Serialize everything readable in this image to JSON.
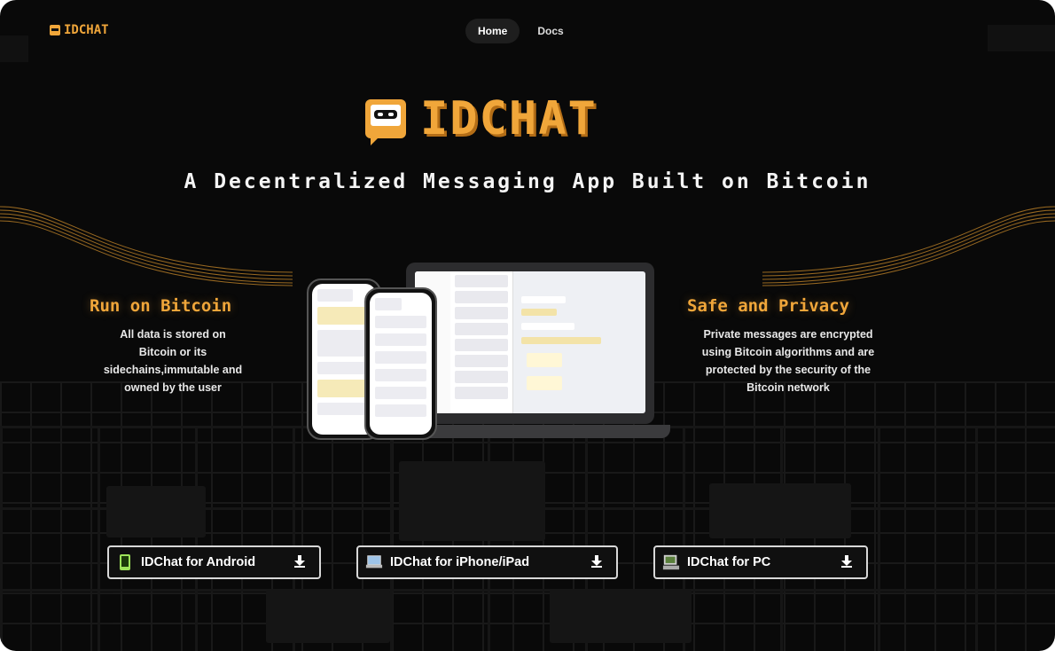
{
  "brand": {
    "name_small": "IDCHAT",
    "name_large": "IDCHAT",
    "accent": "#f0a63a"
  },
  "nav": {
    "items": [
      {
        "label": "Home",
        "active": true
      },
      {
        "label": "Docs",
        "active": false
      }
    ]
  },
  "hero": {
    "tagline": "A Decentralized Messaging App Built on Bitcoin"
  },
  "features": {
    "left": {
      "title": "Run on Bitcoin",
      "lines": [
        "All data is stored on",
        "Bitcoin or its",
        "sidechains,immutable and",
        "owned by the user"
      ]
    },
    "right": {
      "title": "Safe and Privacy",
      "lines": [
        "Private messages are encrypted",
        "using Bitcoin algorithms and are",
        "protected by the security of the",
        "Bitcoin network"
      ]
    }
  },
  "downloads": [
    {
      "label": "IDChat for Android",
      "icon": "android-phone-icon"
    },
    {
      "label": "IDChat for iPhone/iPad",
      "icon": "laptop-icon"
    },
    {
      "label": "IDChat for PC",
      "icon": "desktop-computer-icon"
    }
  ],
  "colors": {
    "background": "#090909",
    "text": "#ffffff",
    "button_border": "#d8d8d8"
  }
}
